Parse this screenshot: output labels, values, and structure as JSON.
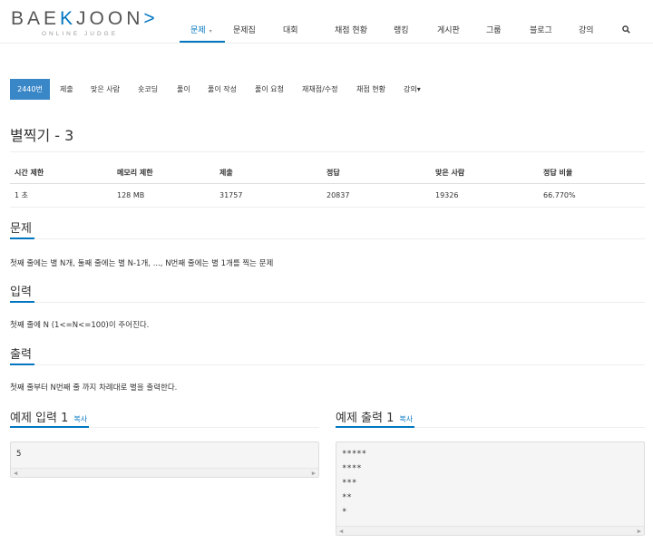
{
  "header": {
    "logo_main": "BAE",
    "logo_bracket_left": "K",
    "logo_rest": "JOON",
    "logo_bracket_right": ">",
    "logo_sub": "ONLINE JUDGE",
    "nav": [
      {
        "label": "문제"
      },
      {
        "label": "문제집"
      },
      {
        "label": "대회"
      },
      {
        "label": "채점 현황"
      },
      {
        "label": "랭킹"
      },
      {
        "label": "게시판"
      },
      {
        "label": "그룹"
      },
      {
        "label": "블로그"
      },
      {
        "label": "강의"
      }
    ],
    "nav_caret": "▾",
    "search_icon": "search-icon"
  },
  "subnav": [
    {
      "label": "2440번"
    },
    {
      "label": "제출"
    },
    {
      "label": "맞은 사람"
    },
    {
      "label": "숏코딩"
    },
    {
      "label": "풀이"
    },
    {
      "label": "풀이 작성"
    },
    {
      "label": "풀이 요청"
    },
    {
      "label": "재채점/수정"
    },
    {
      "label": "채점 현황"
    },
    {
      "label": "강의▾"
    }
  ],
  "problem": {
    "title": "별찍기 - 3",
    "table_headers": [
      "시간 제한",
      "메모리 제한",
      "제출",
      "정답",
      "맞은 사람",
      "정답 비율"
    ],
    "table_values": [
      "1 초",
      "128 MB",
      "31757",
      "20837",
      "19326",
      "66.770%"
    ],
    "description_heading": "문제",
    "description": "첫째 줄에는 별 N개, 둘째 줄에는 별 N-1개, ..., N번째 줄에는 별 1개를 찍는 문제",
    "input_heading": "입력",
    "input_text": "첫째 줄에 N (1<=N<=100)이 주어진다.",
    "output_heading": "출력",
    "output_text": "첫째 줄부터 N번째 줄 까지 차례대로 별을 출력한다.",
    "sample_input_heading": "예제 입력 1",
    "sample_output_heading": "예제 출력 1",
    "copy_label": "복사",
    "sample_input": "5",
    "sample_output": "*****\n****\n***\n**\n*"
  },
  "colors": {
    "accent": "#0076c0",
    "active_tab": "#3a87c8"
  }
}
